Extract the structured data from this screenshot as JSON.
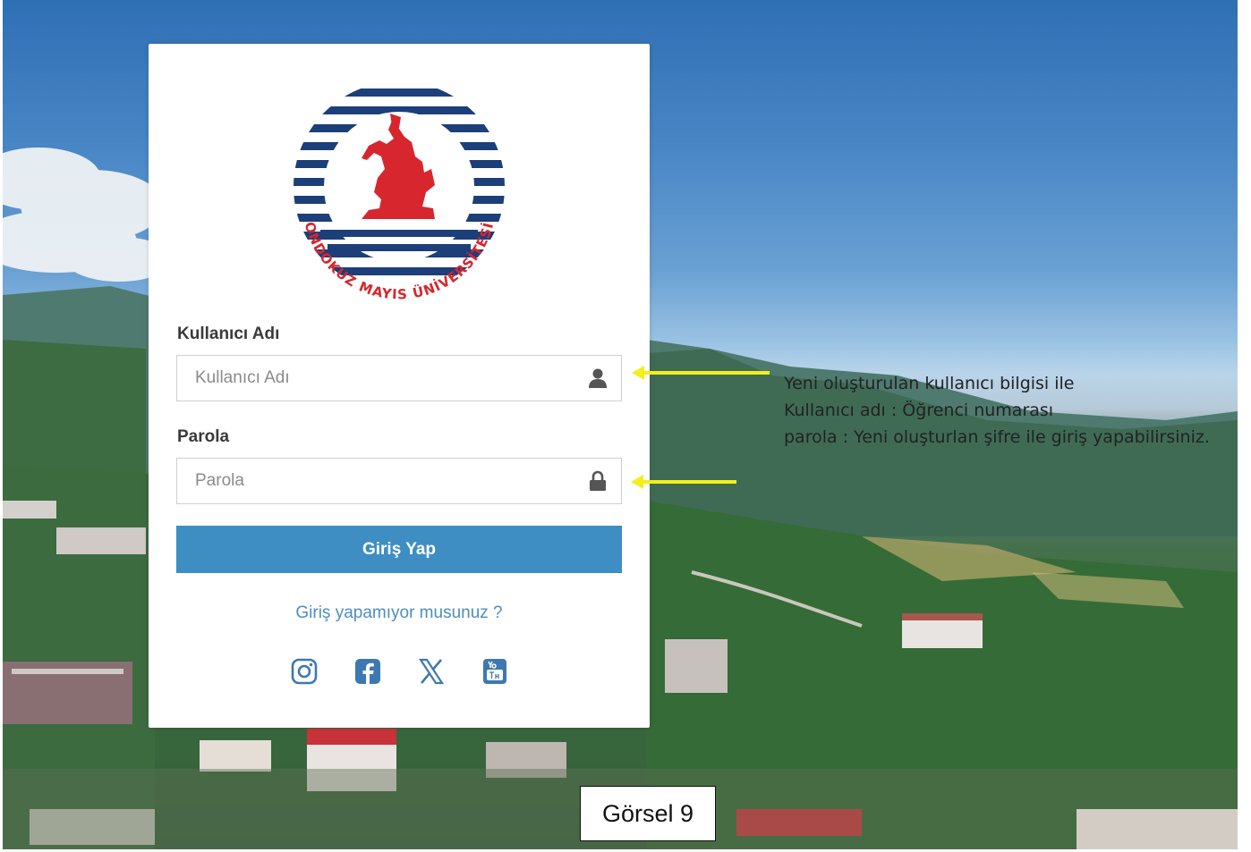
{
  "card": {
    "logo_text": "ONDOKUZ MAYIS ÜNİVERSİTESİ",
    "username_label": "Kullanıcı Adı",
    "username_placeholder": "Kullanıcı Adı",
    "username_value": "",
    "password_label": "Parola",
    "password_placeholder": "Parola",
    "password_value": "",
    "login_button": "Giriş Yap",
    "help_link": "Giriş yapamıyor musunuz ?",
    "socials": [
      "instagram-icon",
      "facebook-icon",
      "x-icon",
      "youtube-icon"
    ]
  },
  "annotation": {
    "lines": [
      "Yeni oluşturulan kullanıcı bilgisi ile",
      "Kullanıcı adı : Öğrenci numarası",
      "parola : Yeni oluşturlan şifre ile giriş yapabilirsiniz."
    ],
    "arrow_color": "#f2ef1a"
  },
  "caption": "Görsel 9",
  "colors": {
    "button": "#3e8ec4",
    "link": "#4b8ec0",
    "logo_blue": "#1c3f7a",
    "logo_red": "#d7262e"
  }
}
